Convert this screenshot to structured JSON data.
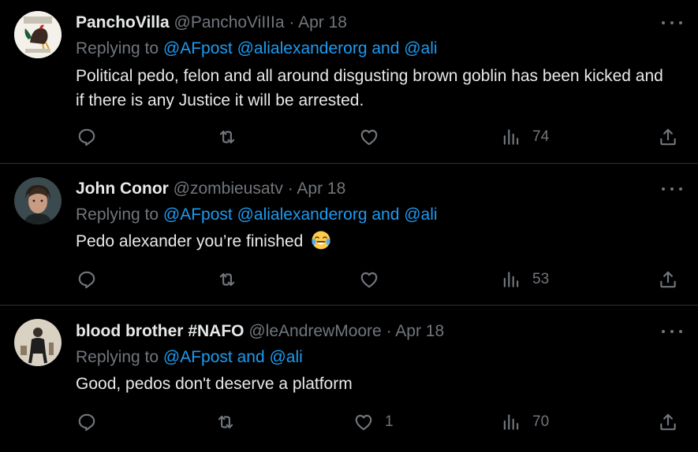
{
  "tweets": [
    {
      "display_name": "PanchoVilla",
      "handle": "@PanchoViIIIa",
      "separator": "·",
      "date": "Apr 18",
      "replying_prefix": "Replying to",
      "replying_to": "@AFpost @alialexanderorg and @ali",
      "text": "Political pedo, felon and all around disgusting brown goblin has been kicked and if there is any Justice it will be arrested.",
      "likes": "",
      "views": "74"
    },
    {
      "display_name": "John Conor",
      "handle": "@zombieusatv",
      "separator": "·",
      "date": "Apr 18",
      "replying_prefix": "Replying to",
      "replying_to": "@AFpost @alialexanderorg and @ali",
      "text": "Pedo alexander you’re finished",
      "emoji": "face-with-tears-of-joy",
      "likes": "",
      "views": "53"
    },
    {
      "display_name": "blood brother #NAFO",
      "handle": "@leAndrewMoore",
      "separator": "·",
      "date": "Apr 18",
      "replying_prefix": "Replying to",
      "replying_to": "@AFpost and @ali",
      "text": "Good, pedos don't deserve a platform",
      "likes": "1",
      "views": "70"
    }
  ],
  "colors": {
    "background": "#000000",
    "primary_text": "#e7e9ea",
    "secondary_text": "#71767b",
    "accent": "#1d9bf0",
    "divider": "#2f3336"
  },
  "icons": [
    "reply-icon",
    "retweet-icon",
    "like-icon",
    "views-icon",
    "share-icon",
    "more-icon"
  ]
}
